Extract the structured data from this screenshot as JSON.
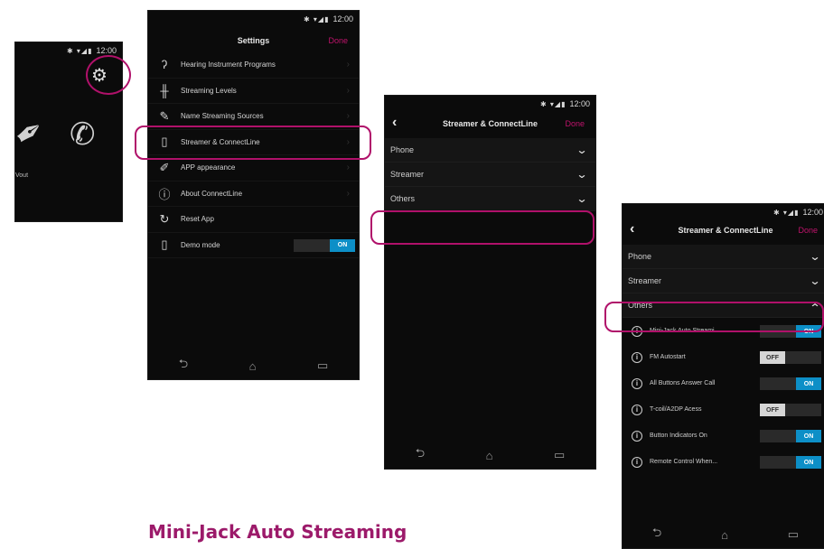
{
  "screen1": {
    "time": "12:00",
    "status_icons": "✱ ▾◢▮",
    "settings_icon": "gear-icon",
    "label": "Vout"
  },
  "screen2": {
    "time": "12:00",
    "status_icons": "✱ ▾◢▮",
    "title": "Settings",
    "done": "Done",
    "items": [
      {
        "label": "Hearing Instrument Programs",
        "icon": "ear-icon"
      },
      {
        "label": "Streaming Levels",
        "icon": "sliders-icon"
      },
      {
        "label": "Name Streaming Sources",
        "icon": "pencil-icon"
      },
      {
        "label": "Streamer & ConnectLine",
        "icon": "streamer-icon"
      },
      {
        "label": "APP appearance",
        "icon": "brush-icon"
      },
      {
        "label": "About ConnectLine",
        "icon": "info-icon"
      },
      {
        "label": "Reset App",
        "icon": "reset-icon"
      },
      {
        "label": "Demo mode",
        "icon": "phone-icon"
      }
    ],
    "demo_toggle": "ON"
  },
  "screen3": {
    "time": "12:00",
    "status_icons": "✱ ▾◢▮",
    "title": "Streamer & ConnectLine",
    "done": "Done",
    "sections": [
      "Phone",
      "Streamer",
      "Others"
    ]
  },
  "screen4": {
    "time": "12:00",
    "status_icons": "✱ ▾◢▮",
    "title": "Streamer & ConnectLine",
    "done": "Done",
    "sections": [
      "Phone",
      "Streamer",
      "Others"
    ],
    "options": [
      {
        "label": "Mini-Jack Auto Streami...",
        "state": "ON"
      },
      {
        "label": "FM Autostart",
        "state": "OFF"
      },
      {
        "label": "All Buttons Answer Call",
        "state": "ON"
      },
      {
        "label": "T-coil/A2DP Acess",
        "state": "OFF"
      },
      {
        "label": "Button Indicators On",
        "state": "ON"
      },
      {
        "label": "Remote Control When...",
        "state": "ON"
      }
    ]
  },
  "nav": {
    "back": "⮌",
    "home": "⌂",
    "recents": "▭"
  },
  "colors": {
    "accent": "#b0116a",
    "toggle_on": "#0d8fc7",
    "background": "#0b0b0b"
  },
  "caption": "Mini-Jack Auto Streaming"
}
